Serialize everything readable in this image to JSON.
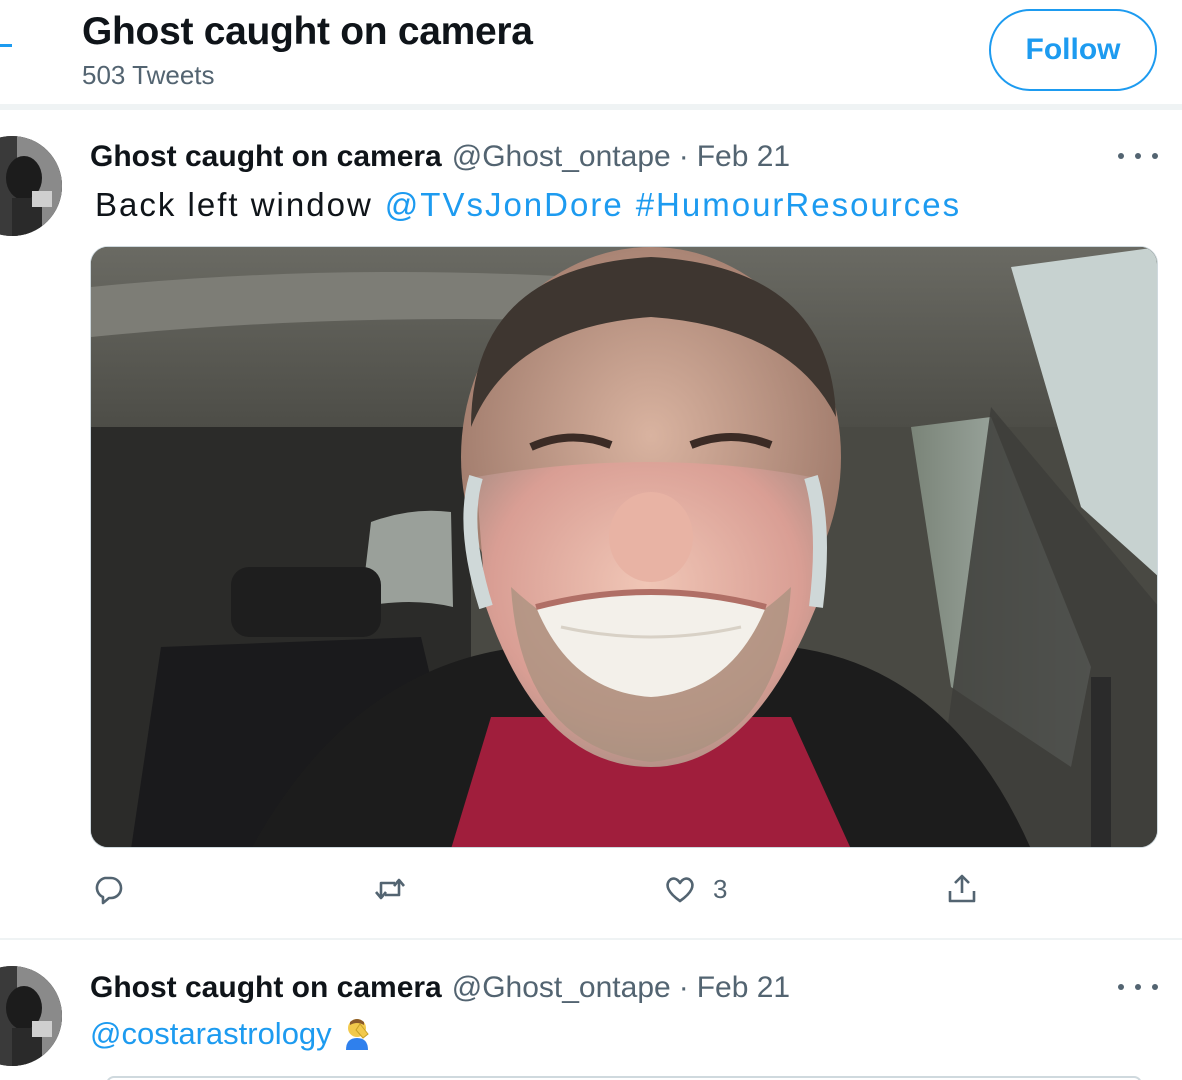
{
  "header": {
    "title": "Ghost caught on camera",
    "subtitle": "503 Tweets",
    "follow_label": "Follow"
  },
  "tweets": [
    {
      "author": "Ghost caught on camera",
      "handle": "@Ghost_ontape",
      "separator": "·",
      "date": "Feb 21",
      "text": "Back left window",
      "mention": "@TVsJonDore",
      "hashtag": "#HumourResources",
      "like_count": "3"
    },
    {
      "author": "Ghost caught on camera",
      "handle": "@Ghost_ontape",
      "separator": "·",
      "date": "Feb 21",
      "mention": "@costarastrology"
    }
  ],
  "colors": {
    "accent": "#1d9bf0",
    "muted": "#536471",
    "text": "#0f1419"
  },
  "icons": [
    "more-icon",
    "reply-icon",
    "retweet-icon",
    "like-icon",
    "share-icon",
    "facepalm-emoji"
  ]
}
